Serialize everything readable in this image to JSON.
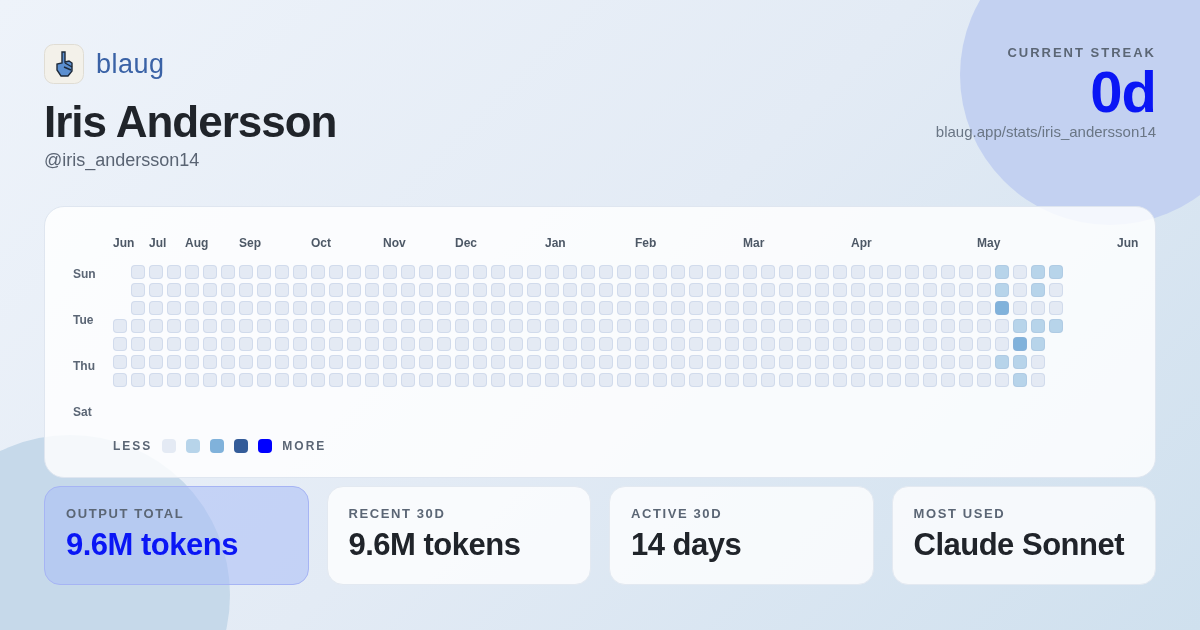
{
  "brand": {
    "name": "blaug"
  },
  "profile": {
    "name": "Iris Andersson",
    "handle": "@iris_andersson14"
  },
  "streak": {
    "label": "CURRENT STREAK",
    "value": "0d",
    "url": "blaug.app/stats/iris_andersson14"
  },
  "heatmap": {
    "day_labels": [
      "Sun",
      "Tue",
      "Thu",
      "Sat"
    ],
    "trailing_month": "Jun",
    "weeks": [
      {
        "month": "Jun",
        "cells": [
          null,
          null,
          null,
          {
            "color": "#e4eaf4"
          },
          {
            "color": "#e4eaf4"
          },
          {
            "color": "#e4eaf4"
          },
          {
            "color": "#e4eaf4"
          }
        ]
      },
      {
        "cells": [
          {
            "color": "#e4eaf4"
          },
          {
            "color": "#e4eaf4"
          },
          {
            "color": "#e4eaf4"
          },
          {
            "color": "#e4eaf4"
          },
          {
            "color": "#e4eaf4"
          },
          {
            "color": "#e4eaf4"
          },
          {
            "color": "#e4eaf4"
          }
        ]
      },
      {
        "month": "Jul",
        "cells": [
          {
            "color": "#e4eaf4"
          },
          {
            "color": "#e4eaf4"
          },
          {
            "color": "#e4eaf4"
          },
          {
            "color": "#e4eaf4"
          },
          {
            "color": "#e4eaf4"
          },
          {
            "color": "#e4eaf4"
          },
          {
            "color": "#e4eaf4"
          }
        ]
      },
      {
        "cells": [
          {
            "color": "#e4eaf4"
          },
          {
            "color": "#e4eaf4"
          },
          {
            "color": "#e4eaf4"
          },
          {
            "color": "#e4eaf4"
          },
          {
            "color": "#e4eaf4"
          },
          {
            "color": "#e4eaf4"
          },
          {
            "color": "#e4eaf4"
          }
        ]
      },
      {
        "month": "Aug",
        "cells": [
          {
            "color": "#e4eaf4"
          },
          {
            "color": "#e4eaf4"
          },
          {
            "color": "#e4eaf4"
          },
          {
            "color": "#e4eaf4"
          },
          {
            "color": "#e4eaf4"
          },
          {
            "color": "#e4eaf4"
          },
          {
            "color": "#e4eaf4"
          }
        ]
      },
      {
        "cells": [
          {
            "color": "#e4eaf4"
          },
          {
            "color": "#e4eaf4"
          },
          {
            "color": "#e4eaf4"
          },
          {
            "color": "#e4eaf4"
          },
          {
            "color": "#e4eaf4"
          },
          {
            "color": "#e4eaf4"
          },
          {
            "color": "#e4eaf4"
          }
        ]
      },
      {
        "cells": [
          {
            "color": "#e4eaf4"
          },
          {
            "color": "#e4eaf4"
          },
          {
            "color": "#e4eaf4"
          },
          {
            "color": "#e4eaf4"
          },
          {
            "color": "#e4eaf4"
          },
          {
            "color": "#e4eaf4"
          },
          {
            "color": "#e4eaf4"
          }
        ]
      },
      {
        "month": "Sep",
        "cells": [
          {
            "color": "#e4eaf4"
          },
          {
            "color": "#e4eaf4"
          },
          {
            "color": "#e4eaf4"
          },
          {
            "color": "#e4eaf4"
          },
          {
            "color": "#e4eaf4"
          },
          {
            "color": "#e4eaf4"
          },
          {
            "color": "#e4eaf4"
          }
        ]
      },
      {
        "cells": [
          {
            "color": "#e4eaf4"
          },
          {
            "color": "#e4eaf4"
          },
          {
            "color": "#e4eaf4"
          },
          {
            "color": "#e4eaf4"
          },
          {
            "color": "#e4eaf4"
          },
          {
            "color": "#e4eaf4"
          },
          {
            "color": "#e4eaf4"
          }
        ]
      },
      {
        "cells": [
          {
            "color": "#e4eaf4"
          },
          {
            "color": "#e4eaf4"
          },
          {
            "color": "#e4eaf4"
          },
          {
            "color": "#e4eaf4"
          },
          {
            "color": "#e4eaf4"
          },
          {
            "color": "#e4eaf4"
          },
          {
            "color": "#e4eaf4"
          }
        ]
      },
      {
        "cells": [
          {
            "color": "#e4eaf4"
          },
          {
            "color": "#e4eaf4"
          },
          {
            "color": "#e4eaf4"
          },
          {
            "color": "#e4eaf4"
          },
          {
            "color": "#e4eaf4"
          },
          {
            "color": "#e4eaf4"
          },
          {
            "color": "#e4eaf4"
          }
        ]
      },
      {
        "month": "Oct",
        "cells": [
          {
            "color": "#e4eaf4"
          },
          {
            "color": "#e4eaf4"
          },
          {
            "color": "#e4eaf4"
          },
          {
            "color": "#e4eaf4"
          },
          {
            "color": "#e4eaf4"
          },
          {
            "color": "#e4eaf4"
          },
          {
            "color": "#e4eaf4"
          }
        ]
      },
      {
        "cells": [
          {
            "color": "#e4eaf4"
          },
          {
            "color": "#e4eaf4"
          },
          {
            "color": "#e4eaf4"
          },
          {
            "color": "#e4eaf4"
          },
          {
            "color": "#e4eaf4"
          },
          {
            "color": "#e4eaf4"
          },
          {
            "color": "#e4eaf4"
          }
        ]
      },
      {
        "cells": [
          {
            "color": "#e4eaf4"
          },
          {
            "color": "#e4eaf4"
          },
          {
            "color": "#e4eaf4"
          },
          {
            "color": "#e4eaf4"
          },
          {
            "color": "#e4eaf4"
          },
          {
            "color": "#e4eaf4"
          },
          {
            "color": "#e4eaf4"
          }
        ]
      },
      {
        "cells": [
          {
            "color": "#e4eaf4"
          },
          {
            "color": "#e4eaf4"
          },
          {
            "color": "#e4eaf4"
          },
          {
            "color": "#e4eaf4"
          },
          {
            "color": "#e4eaf4"
          },
          {
            "color": "#e4eaf4"
          },
          {
            "color": "#e4eaf4"
          }
        ]
      },
      {
        "month": "Nov",
        "cells": [
          {
            "color": "#e4eaf4"
          },
          {
            "color": "#e4eaf4"
          },
          {
            "color": "#e4eaf4"
          },
          {
            "color": "#e4eaf4"
          },
          {
            "color": "#e4eaf4"
          },
          {
            "color": "#e4eaf4"
          },
          {
            "color": "#e4eaf4"
          }
        ]
      },
      {
        "cells": [
          {
            "color": "#e4eaf4"
          },
          {
            "color": "#e4eaf4"
          },
          {
            "color": "#e4eaf4"
          },
          {
            "color": "#e4eaf4"
          },
          {
            "color": "#e4eaf4"
          },
          {
            "color": "#e4eaf4"
          },
          {
            "color": "#e4eaf4"
          }
        ]
      },
      {
        "cells": [
          {
            "color": "#e4eaf4"
          },
          {
            "color": "#e4eaf4"
          },
          {
            "color": "#e4eaf4"
          },
          {
            "color": "#e4eaf4"
          },
          {
            "color": "#e4eaf4"
          },
          {
            "color": "#e4eaf4"
          },
          {
            "color": "#e4eaf4"
          }
        ]
      },
      {
        "cells": [
          {
            "color": "#e4eaf4"
          },
          {
            "color": "#e4eaf4"
          },
          {
            "color": "#e4eaf4"
          },
          {
            "color": "#e4eaf4"
          },
          {
            "color": "#e4eaf4"
          },
          {
            "color": "#e4eaf4"
          },
          {
            "color": "#e4eaf4"
          }
        ]
      },
      {
        "month": "Dec",
        "cells": [
          {
            "color": "#e4eaf4"
          },
          {
            "color": "#e4eaf4"
          },
          {
            "color": "#e4eaf4"
          },
          {
            "color": "#e4eaf4"
          },
          {
            "color": "#e4eaf4"
          },
          {
            "color": "#e4eaf4"
          },
          {
            "color": "#e4eaf4"
          }
        ]
      },
      {
        "cells": [
          {
            "color": "#e4eaf4"
          },
          {
            "color": "#e4eaf4"
          },
          {
            "color": "#e4eaf4"
          },
          {
            "color": "#e4eaf4"
          },
          {
            "color": "#e4eaf4"
          },
          {
            "color": "#e4eaf4"
          },
          {
            "color": "#e4eaf4"
          }
        ]
      },
      {
        "cells": [
          {
            "color": "#e4eaf4"
          },
          {
            "color": "#e4eaf4"
          },
          {
            "color": "#e4eaf4"
          },
          {
            "color": "#e4eaf4"
          },
          {
            "color": "#e4eaf4"
          },
          {
            "color": "#e4eaf4"
          },
          {
            "color": "#e4eaf4"
          }
        ]
      },
      {
        "cells": [
          {
            "color": "#e4eaf4"
          },
          {
            "color": "#e4eaf4"
          },
          {
            "color": "#e4eaf4"
          },
          {
            "color": "#e4eaf4"
          },
          {
            "color": "#e4eaf4"
          },
          {
            "color": "#e4eaf4"
          },
          {
            "color": "#e4eaf4"
          }
        ]
      },
      {
        "cells": [
          {
            "color": "#e4eaf4"
          },
          {
            "color": "#e4eaf4"
          },
          {
            "color": "#e4eaf4"
          },
          {
            "color": "#e4eaf4"
          },
          {
            "color": "#e4eaf4"
          },
          {
            "color": "#e4eaf4"
          },
          {
            "color": "#e4eaf4"
          }
        ]
      },
      {
        "month": "Jan",
        "cells": [
          {
            "color": "#e4eaf4"
          },
          {
            "color": "#e4eaf4"
          },
          {
            "color": "#e4eaf4"
          },
          {
            "color": "#e4eaf4"
          },
          {
            "color": "#e4eaf4"
          },
          {
            "color": "#e4eaf4"
          },
          {
            "color": "#e4eaf4"
          }
        ]
      },
      {
        "cells": [
          {
            "color": "#e4eaf4"
          },
          {
            "color": "#e4eaf4"
          },
          {
            "color": "#e4eaf4"
          },
          {
            "color": "#e4eaf4"
          },
          {
            "color": "#e4eaf4"
          },
          {
            "color": "#e4eaf4"
          },
          {
            "color": "#e4eaf4"
          }
        ]
      },
      {
        "cells": [
          {
            "color": "#e4eaf4"
          },
          {
            "color": "#e4eaf4"
          },
          {
            "color": "#e4eaf4"
          },
          {
            "color": "#e4eaf4"
          },
          {
            "color": "#e4eaf4"
          },
          {
            "color": "#e4eaf4"
          },
          {
            "color": "#e4eaf4"
          }
        ]
      },
      {
        "cells": [
          {
            "color": "#e4eaf4"
          },
          {
            "color": "#e4eaf4"
          },
          {
            "color": "#e4eaf4"
          },
          {
            "color": "#e4eaf4"
          },
          {
            "color": "#e4eaf4"
          },
          {
            "color": "#e4eaf4"
          },
          {
            "color": "#e4eaf4"
          }
        ]
      },
      {
        "cells": [
          {
            "color": "#e4eaf4"
          },
          {
            "color": "#e4eaf4"
          },
          {
            "color": "#e4eaf4"
          },
          {
            "color": "#e4eaf4"
          },
          {
            "color": "#e4eaf4"
          },
          {
            "color": "#e4eaf4"
          },
          {
            "color": "#e4eaf4"
          }
        ]
      },
      {
        "month": "Feb",
        "cells": [
          {
            "color": "#e4eaf4"
          },
          {
            "color": "#e4eaf4"
          },
          {
            "color": "#e4eaf4"
          },
          {
            "color": "#e4eaf4"
          },
          {
            "color": "#e4eaf4"
          },
          {
            "color": "#e4eaf4"
          },
          {
            "color": "#e4eaf4"
          }
        ]
      },
      {
        "cells": [
          {
            "color": "#e4eaf4"
          },
          {
            "color": "#e4eaf4"
          },
          {
            "color": "#e4eaf4"
          },
          {
            "color": "#e4eaf4"
          },
          {
            "color": "#e4eaf4"
          },
          {
            "color": "#e4eaf4"
          },
          {
            "color": "#e4eaf4"
          }
        ]
      },
      {
        "cells": [
          {
            "color": "#e4eaf4"
          },
          {
            "color": "#e4eaf4"
          },
          {
            "color": "#e4eaf4"
          },
          {
            "color": "#e4eaf4"
          },
          {
            "color": "#e4eaf4"
          },
          {
            "color": "#e4eaf4"
          },
          {
            "color": "#e4eaf4"
          }
        ]
      },
      {
        "cells": [
          {
            "color": "#e4eaf4"
          },
          {
            "color": "#e4eaf4"
          },
          {
            "color": "#e4eaf4"
          },
          {
            "color": "#e4eaf4"
          },
          {
            "color": "#e4eaf4"
          },
          {
            "color": "#e4eaf4"
          },
          {
            "color": "#e4eaf4"
          }
        ]
      },
      {
        "cells": [
          {
            "color": "#e4eaf4"
          },
          {
            "color": "#e4eaf4"
          },
          {
            "color": "#e4eaf4"
          },
          {
            "color": "#e4eaf4"
          },
          {
            "color": "#e4eaf4"
          },
          {
            "color": "#e4eaf4"
          },
          {
            "color": "#e4eaf4"
          }
        ]
      },
      {
        "cells": [
          {
            "color": "#e4eaf4"
          },
          {
            "color": "#e4eaf4"
          },
          {
            "color": "#e4eaf4"
          },
          {
            "color": "#e4eaf4"
          },
          {
            "color": "#e4eaf4"
          },
          {
            "color": "#e4eaf4"
          },
          {
            "color": "#e4eaf4"
          }
        ]
      },
      {
        "month": "Mar",
        "cells": [
          {
            "color": "#e4eaf4"
          },
          {
            "color": "#e4eaf4"
          },
          {
            "color": "#e4eaf4"
          },
          {
            "color": "#e4eaf4"
          },
          {
            "color": "#e4eaf4"
          },
          {
            "color": "#e4eaf4"
          },
          {
            "color": "#e4eaf4"
          }
        ]
      },
      {
        "cells": [
          {
            "color": "#e4eaf4"
          },
          {
            "color": "#e4eaf4"
          },
          {
            "color": "#e4eaf4"
          },
          {
            "color": "#e4eaf4"
          },
          {
            "color": "#e4eaf4"
          },
          {
            "color": "#e4eaf4"
          },
          {
            "color": "#e4eaf4"
          }
        ]
      },
      {
        "cells": [
          {
            "color": "#e4eaf4"
          },
          {
            "color": "#e4eaf4"
          },
          {
            "color": "#e4eaf4"
          },
          {
            "color": "#e4eaf4"
          },
          {
            "color": "#e4eaf4"
          },
          {
            "color": "#e4eaf4"
          },
          {
            "color": "#e4eaf4"
          }
        ]
      },
      {
        "cells": [
          {
            "color": "#e4eaf4"
          },
          {
            "color": "#e4eaf4"
          },
          {
            "color": "#e4eaf4"
          },
          {
            "color": "#e4eaf4"
          },
          {
            "color": "#e4eaf4"
          },
          {
            "color": "#e4eaf4"
          },
          {
            "color": "#e4eaf4"
          }
        ]
      },
      {
        "cells": [
          {
            "color": "#e4eaf4"
          },
          {
            "color": "#e4eaf4"
          },
          {
            "color": "#e4eaf4"
          },
          {
            "color": "#e4eaf4"
          },
          {
            "color": "#e4eaf4"
          },
          {
            "color": "#e4eaf4"
          },
          {
            "color": "#e4eaf4"
          }
        ]
      },
      {
        "cells": [
          {
            "color": "#e4eaf4"
          },
          {
            "color": "#e4eaf4"
          },
          {
            "color": "#e4eaf4"
          },
          {
            "color": "#e4eaf4"
          },
          {
            "color": "#e4eaf4"
          },
          {
            "color": "#e4eaf4"
          },
          {
            "color": "#e4eaf4"
          }
        ]
      },
      {
        "month": "Apr",
        "cells": [
          {
            "color": "#e4eaf4"
          },
          {
            "color": "#e4eaf4"
          },
          {
            "color": "#e4eaf4"
          },
          {
            "color": "#e4eaf4"
          },
          {
            "color": "#e4eaf4"
          },
          {
            "color": "#e4eaf4"
          },
          {
            "color": "#e4eaf4"
          }
        ]
      },
      {
        "cells": [
          {
            "color": "#e4eaf4"
          },
          {
            "color": "#e4eaf4"
          },
          {
            "color": "#e4eaf4"
          },
          {
            "color": "#e4eaf4"
          },
          {
            "color": "#e4eaf4"
          },
          {
            "color": "#e4eaf4"
          },
          {
            "color": "#e4eaf4"
          }
        ]
      },
      {
        "cells": [
          {
            "color": "#e4eaf4"
          },
          {
            "color": "#e4eaf4"
          },
          {
            "color": "#e4eaf4"
          },
          {
            "color": "#e4eaf4"
          },
          {
            "color": "#e4eaf4"
          },
          {
            "color": "#e4eaf4"
          },
          {
            "color": "#e4eaf4"
          }
        ]
      },
      {
        "cells": [
          {
            "color": "#e4eaf4"
          },
          {
            "color": "#e4eaf4"
          },
          {
            "color": "#e4eaf4"
          },
          {
            "color": "#e4eaf4"
          },
          {
            "color": "#e4eaf4"
          },
          {
            "color": "#e4eaf4"
          },
          {
            "color": "#e4eaf4"
          }
        ]
      },
      {
        "cells": [
          {
            "color": "#e4eaf4"
          },
          {
            "color": "#e4eaf4"
          },
          {
            "color": "#e4eaf4"
          },
          {
            "color": "#e4eaf4"
          },
          {
            "color": "#e4eaf4"
          },
          {
            "color": "#e4eaf4"
          },
          {
            "color": "#e4eaf4"
          }
        ]
      },
      {
        "cells": [
          {
            "color": "#e4eaf4"
          },
          {
            "color": "#e4eaf4"
          },
          {
            "color": "#e4eaf4"
          },
          {
            "color": "#e4eaf4"
          },
          {
            "color": "#e4eaf4"
          },
          {
            "color": "#e4eaf4"
          },
          {
            "color": "#e4eaf4"
          }
        ]
      },
      {
        "cells": [
          {
            "color": "#e4eaf4"
          },
          {
            "color": "#e4eaf4"
          },
          {
            "color": "#e4eaf4"
          },
          {
            "color": "#e4eaf4"
          },
          {
            "color": "#e4eaf4"
          },
          {
            "color": "#e4eaf4"
          },
          {
            "color": "#e4eaf4"
          }
        ]
      },
      {
        "month": "May",
        "cells": [
          {
            "color": "#e4eaf4"
          },
          {
            "color": "#e4eaf4"
          },
          {
            "color": "#e4eaf4"
          },
          {
            "color": "#e4eaf4"
          },
          {
            "color": "#e4eaf4"
          },
          {
            "color": "#e4eaf4"
          },
          {
            "color": "#e4eaf4"
          }
        ]
      },
      {
        "cells": [
          {
            "color": "#b7d4ea"
          },
          {
            "color": "#b7d4ea"
          },
          {
            "color": "#80b2db"
          },
          {
            "color": "#e4eaf4"
          },
          {
            "color": "#e4eaf4"
          },
          {
            "color": "#b7d4ea"
          },
          {
            "color": "#e4eaf4"
          }
        ]
      },
      {
        "cells": [
          {
            "color": "#e4eaf4"
          },
          {
            "color": "#e4eaf4"
          },
          {
            "color": "#e4eaf4"
          },
          {
            "color": "#b7d4ea"
          },
          {
            "color": "#80b2db"
          },
          {
            "color": "#b7d4ea"
          },
          {
            "color": "#b7d4ea"
          }
        ]
      },
      {
        "cells": [
          {
            "color": "#b7d4ea"
          },
          {
            "color": "#b7d4ea"
          },
          {
            "color": "#e4eaf4"
          },
          {
            "color": "#b7d4ea"
          },
          {
            "color": "#b7d4ea"
          },
          {
            "color": "#e4eaf4"
          },
          {
            "color": "#e4eaf4"
          }
        ]
      },
      {
        "cells": [
          {
            "color": "#b7d4ea"
          },
          {
            "color": "#e4eaf4"
          },
          {
            "color": "#e4eaf4"
          },
          {
            "color": "#b7d4ea"
          },
          null,
          null,
          null
        ]
      }
    ],
    "legend": {
      "less_label": "LESS",
      "more_label": "MORE",
      "swatches": [
        {
          "color": "#e4eaf4"
        },
        {
          "color": "#b7d4ea"
        },
        {
          "color": "#80b2db"
        },
        {
          "color": "#345c99"
        },
        {
          "color": "#0000ff"
        }
      ]
    }
  },
  "stats": [
    {
      "label": "OUTPUT TOTAL",
      "value": "9.6M tokens",
      "highlighted": true
    },
    {
      "label": "RECENT 30D",
      "value": "9.6M tokens",
      "highlighted": false
    },
    {
      "label": "ACTIVE 30D",
      "value": "14 days",
      "highlighted": false
    },
    {
      "label": "MOST USED",
      "value": "Claude Sonnet",
      "highlighted": false
    }
  ]
}
